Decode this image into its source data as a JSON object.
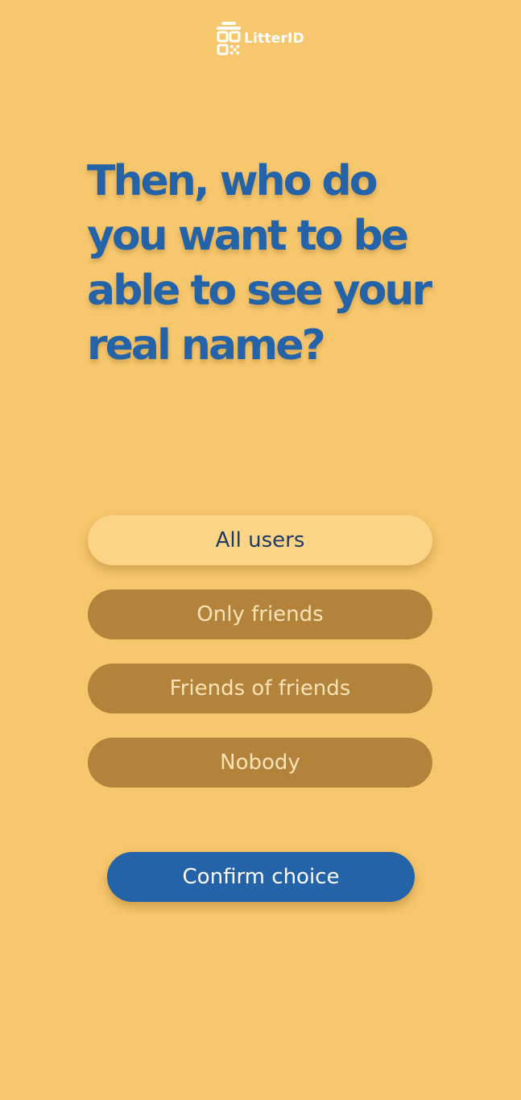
{
  "brand": {
    "name": "LitterID",
    "icon": "litter-id-logo-icon"
  },
  "question": {
    "text": "Then, who do you want to be able to see your real name?"
  },
  "options": [
    {
      "label": "All users",
      "selected": true
    },
    {
      "label": "Only friends",
      "selected": false
    },
    {
      "label": "Friends of friends",
      "selected": false
    },
    {
      "label": "Nobody",
      "selected": false
    }
  ],
  "confirm": {
    "label": "Confirm choice"
  },
  "colors": {
    "background": "#F7C76D",
    "accent": "#2563A8",
    "option_selected": "#FBD486",
    "option_unselected": "#B3833B"
  }
}
